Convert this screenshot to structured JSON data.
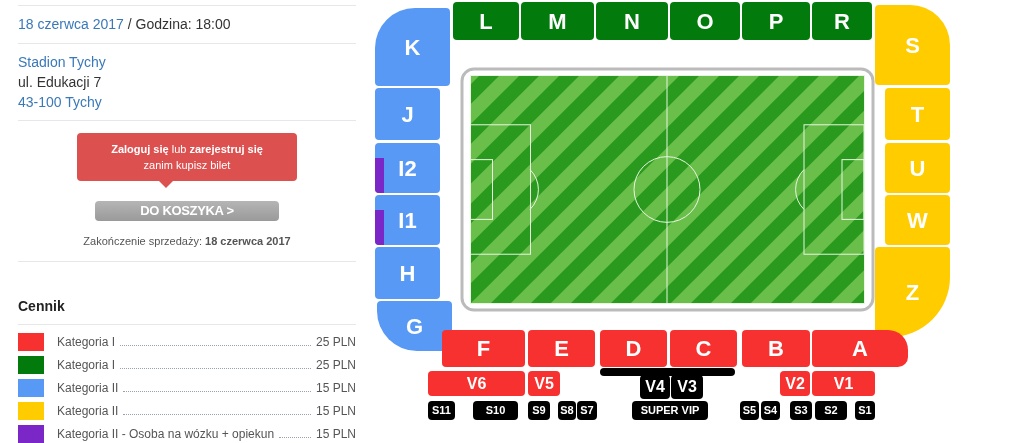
{
  "event": {
    "date": "18 czerwca 2017",
    "time_label": "/ Godzina: 18:00"
  },
  "venue": {
    "name": "Stadion Tychy",
    "street": "ul. Edukacji 7",
    "city": "43-100 Tychy"
  },
  "login_notice": {
    "text": "**Zaloguj się** lub **zarejestruj się**",
    "subtext": "zanim kupisz bilet"
  },
  "cart_button": {
    "label": "DO KOSZYKA >",
    "disabled": true
  },
  "sale_end": "Zakończenie sprzedaży: **18 czerwca 2017**",
  "price_list": {
    "title": "Cennik",
    "items": [
      {
        "label": "Kategoria I",
        "price": "25 PLN",
        "color": "#f73030"
      },
      {
        "label": "Kategoria I",
        "price": "25 PLN",
        "color": "#037a0c"
      },
      {
        "label": "Kategoria II",
        "price": "15 PLN",
        "color": "#5799f5"
      },
      {
        "label": "Kategoria II",
        "price": "15 PLN",
        "color": "#ffcc00"
      },
      {
        "label": "Kategoria II - Osoba na wózku + opiekun",
        "price": "15 PLN",
        "color": "#7b26c7"
      }
    ]
  },
  "stadium": {
    "sectors": [
      {
        "label": "L",
        "color": "#037a0c"
      },
      {
        "label": "M",
        "color": "#037a0c"
      },
      {
        "label": "N",
        "color": "#037a0c"
      },
      {
        "label": "O",
        "color": "#037a0c"
      },
      {
        "label": "P",
        "color": "#037a0c"
      },
      {
        "label": "R",
        "color": "#037a0c"
      },
      {
        "label": "K",
        "color": "#5799f5"
      },
      {
        "label": "J",
        "color": "#5799f5"
      },
      {
        "label": "I2",
        "color": "#5799f5",
        "accessible": true
      },
      {
        "label": "I1",
        "color": "#5799f5",
        "accessible": true
      },
      {
        "label": "H",
        "color": "#5799f5"
      },
      {
        "label": "G",
        "color": "#5799f5"
      },
      {
        "label": "S",
        "color": "#ffcc00"
      },
      {
        "label": "T",
        "color": "#ffcc00"
      },
      {
        "label": "U",
        "color": "#ffcc00"
      },
      {
        "label": "W",
        "color": "#ffcc00"
      },
      {
        "label": "Z",
        "color": "#ffcc00"
      },
      {
        "label": "F",
        "color": "#f73030"
      },
      {
        "label": "E",
        "color": "#f73030"
      },
      {
        "label": "D",
        "color": "#f73030"
      },
      {
        "label": "C",
        "color": "#f73030"
      },
      {
        "label": "B",
        "color": "#f73030"
      },
      {
        "label": "A",
        "color": "#f73030"
      },
      {
        "label": "V6",
        "color": "#f73030"
      },
      {
        "label": "V5",
        "color": "#f73030"
      },
      {
        "label": "V4",
        "color": "#000000"
      },
      {
        "label": "V3",
        "color": "#000000"
      },
      {
        "label": "V2",
        "color": "#f73030"
      },
      {
        "label": "V1",
        "color": "#f73030"
      },
      {
        "label": "S11",
        "color": "#000000"
      },
      {
        "label": "S10",
        "color": "#000000"
      },
      {
        "label": "S9",
        "color": "#000000"
      },
      {
        "label": "S8",
        "color": "#000000"
      },
      {
        "label": "S7",
        "color": "#000000"
      },
      {
        "label": "SUPER VIP",
        "color": "#000000"
      },
      {
        "label": "S5",
        "color": "#000000"
      },
      {
        "label": "S4",
        "color": "#000000"
      },
      {
        "label": "S3",
        "color": "#000000"
      },
      {
        "label": "S2",
        "color": "#000000"
      },
      {
        "label": "S1",
        "color": "#000000"
      }
    ]
  }
}
